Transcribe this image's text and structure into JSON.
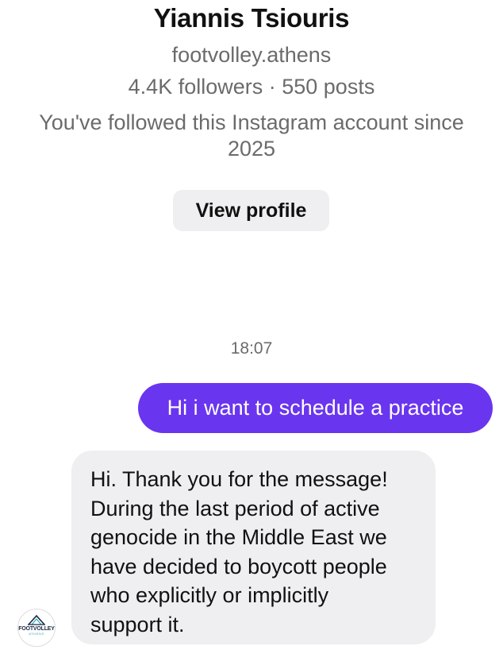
{
  "profile": {
    "name": "Yiannis Tsiouris",
    "username": "footvolley.athens",
    "stats": "4.4K followers · 550 posts",
    "followed_since_line1": "You've followed this Instagram account since",
    "followed_since_line2": "2025",
    "view_profile_label": "View profile"
  },
  "chat": {
    "timestamp": "18:07",
    "outgoing_message": "Hi i want to schedule a practice",
    "incoming_message_lines": [
      "Hi. Thank you for the message!",
      "During the last period of active",
      "genocide in the Middle East we",
      "have decided to boycott people",
      "who explicitly or implicitly",
      "support it."
    ],
    "avatar_logo_text": "FOOTVOLLEY",
    "avatar_logo_sub": "ATHENS"
  },
  "colors": {
    "outgoing_bubble": "#6a35ef",
    "incoming_bubble": "#efeff1",
    "button_bg": "#efeff1",
    "secondary_text": "#6b6b6b"
  },
  "icons": {
    "avatar": "footvolley-athens-logo-icon"
  }
}
